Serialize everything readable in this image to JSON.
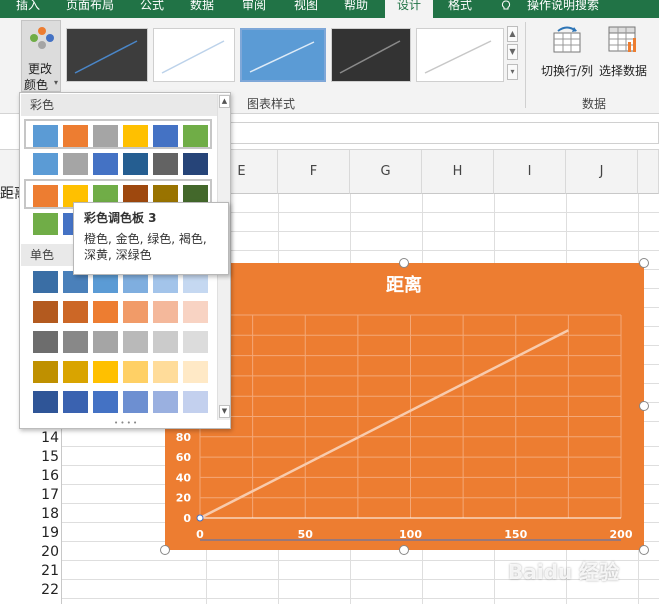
{
  "tabs": [
    "插入",
    "页面布局",
    "公式",
    "数据",
    "审阅",
    "视图",
    "帮助",
    "设计",
    "格式",
    "操作说明搜索"
  ],
  "active_tab": "设计",
  "ribbon": {
    "change_colors_line1": "更改",
    "change_colors_line2": "颜色",
    "chart_styles_label": "图表样式",
    "switch_row_col": "切换行/列",
    "select_data": "选择数据",
    "data_group_label": "数据"
  },
  "columns": [
    "E",
    "F",
    "G",
    "H",
    "I",
    "J"
  ],
  "cell_partial": "距离",
  "rows": [
    "14",
    "15",
    "16",
    "17",
    "18",
    "19",
    "20",
    "21",
    "22"
  ],
  "dropdown": {
    "colorful_label": "彩色",
    "mono_label": "单色",
    "more_dots": "• • • •",
    "colorful_rows": [
      [
        "#5b9bd5",
        "#ed7d31",
        "#a5a5a5",
        "#ffc000",
        "#4472c4",
        "#70ad47"
      ],
      [
        "#5b9bd5",
        "#a5a5a5",
        "#4472c4",
        "#255e91",
        "#636363",
        "#264478"
      ],
      [
        "#ed7d31",
        "#ffc000",
        "#70ad47",
        "#9e480e",
        "#997300",
        "#43682b"
      ],
      [
        "#70ad47",
        "#4472c4"
      ]
    ],
    "mono_rows": [
      [
        "#3a6ea5",
        "#4a80ba",
        "#5b9bd5",
        "#7faedf",
        "#a3c4ea",
        "#c5d8f1"
      ],
      [
        "#b35a1f",
        "#cc6726",
        "#ed7d31",
        "#f19b68",
        "#f4b89b",
        "#f8d3c3"
      ],
      [
        "#6d6d6d",
        "#888888",
        "#a5a5a5",
        "#b9b9b9",
        "#cbcbcb",
        "#dcdcdc"
      ],
      [
        "#bf9000",
        "#d9a400",
        "#ffc000",
        "#ffd065",
        "#ffdc9a",
        "#ffe9c6"
      ],
      [
        "#2f5597",
        "#3a62b0",
        "#4472c4",
        "#6d8fd1",
        "#9ab0e0",
        "#c3d0ee"
      ]
    ]
  },
  "tooltip": {
    "title": "彩色调色板 3",
    "line1": "橙色, 金色, 绿色, 褐色,",
    "line2": "深黄, 深绿色"
  },
  "chart_data": {
    "type": "line",
    "title": "距离",
    "x_ticks": [
      "0",
      "50",
      "100",
      "150",
      "200"
    ],
    "y_ticks": [
      "0",
      "20",
      "40",
      "60",
      "80"
    ],
    "series": [
      {
        "x": [
          0,
          175
        ],
        "y": [
          0,
          185
        ]
      }
    ],
    "xlim": [
      0,
      200
    ],
    "ylim": [
      0,
      200
    ],
    "grid": true,
    "colors": {
      "background": "#ed7d31",
      "line": "#f8cbad",
      "grid": "#f4a877"
    }
  },
  "watermark": "Baidu 经验"
}
